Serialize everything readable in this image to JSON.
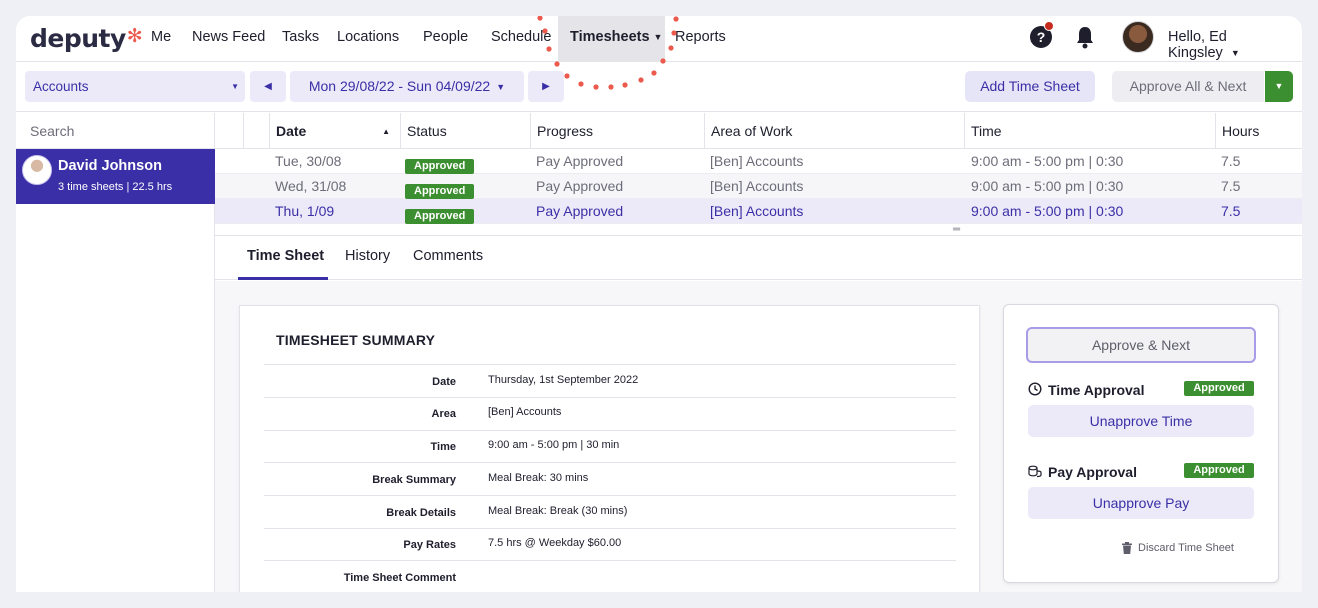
{
  "brand": {
    "logo_text": "deputy",
    "logo_mark": "✻",
    "accent": "#3a2fa6",
    "logo_accent": "#ec5a4d"
  },
  "nav": {
    "items": [
      {
        "label": "Me"
      },
      {
        "label": "News Feed"
      },
      {
        "label": "Tasks"
      },
      {
        "label": "Locations"
      },
      {
        "label": "People"
      },
      {
        "label": "Schedule"
      },
      {
        "label": "Timesheets",
        "active": true
      },
      {
        "label": "Reports"
      }
    ],
    "help_icon": "question-circle-icon",
    "bell_icon": "bell-icon",
    "greeting": "Hello, Ed Kingsley"
  },
  "toolbar": {
    "location_select": "Accounts",
    "date_range": "Mon 29/08/22 - Sun 04/09/22",
    "add_button": "Add Time Sheet",
    "approve_all_button": "Approve All & Next",
    "approve_color": "#3c8f30"
  },
  "left_panel": {
    "search_placeholder": "Search",
    "person": {
      "name": "David Johnson",
      "summary": "3 time sheets | 22.5 hrs"
    }
  },
  "table": {
    "columns": [
      "Date",
      "Status",
      "Progress",
      "Area of Work",
      "Time",
      "Hours"
    ],
    "rows": [
      {
        "date": "Tue, 30/08",
        "status": "Approved",
        "progress": "Pay Approved",
        "area": "[Ben] Accounts",
        "time": "9:00 am - 5:00 pm | 0:30",
        "hours": "7.5"
      },
      {
        "date": "Wed, 31/08",
        "status": "Approved",
        "progress": "Pay Approved",
        "area": "[Ben] Accounts",
        "time": "9:00 am - 5:00 pm | 0:30",
        "hours": "7.5"
      },
      {
        "date": "Thu, 1/09",
        "status": "Approved",
        "progress": "Pay Approved",
        "area": "[Ben] Accounts",
        "time": "9:00 am - 5:00 pm | 0:30",
        "hours": "7.5"
      }
    ]
  },
  "tabs": [
    {
      "label": "Time Sheet",
      "active": true
    },
    {
      "label": "History"
    },
    {
      "label": "Comments"
    }
  ],
  "summary": {
    "title": "TIMESHEET SUMMARY",
    "rows": [
      {
        "label": "Date",
        "value": "Thursday, 1st September 2022"
      },
      {
        "label": "Area",
        "value": "[Ben] Accounts"
      },
      {
        "label": "Time",
        "value": "9:00 am - 5:00 pm | 30 min"
      },
      {
        "label": "Break Summary",
        "value": "Meal Break: 30 mins"
      },
      {
        "label": "Break Details",
        "value": "Meal Break: Break (30 mins)"
      },
      {
        "label": "Pay Rates",
        "value": "7.5 hrs @ Weekday $60.00"
      },
      {
        "label": "Time Sheet Comment",
        "value": ""
      }
    ]
  },
  "approval": {
    "approve_next": "Approve & Next",
    "time_title": "Time Approval",
    "time_status": "Approved",
    "unapprove_time": "Unapprove Time",
    "pay_title": "Pay Approval",
    "pay_status": "Approved",
    "unapprove_pay": "Unapprove Pay",
    "discard": "Discard Time Sheet"
  }
}
